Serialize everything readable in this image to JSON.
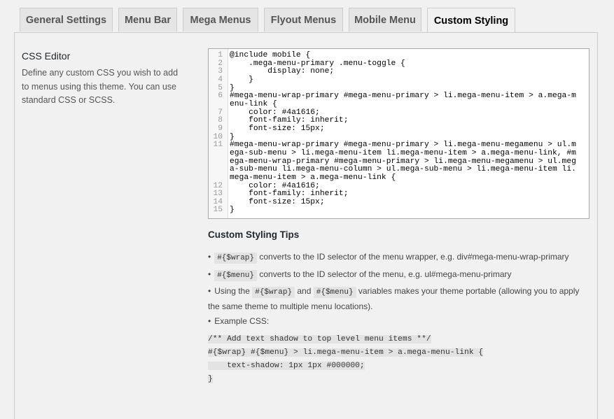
{
  "tabs": [
    {
      "label": "General Settings",
      "active": false
    },
    {
      "label": "Menu Bar",
      "active": false
    },
    {
      "label": "Mega Menus",
      "active": false
    },
    {
      "label": "Flyout Menus",
      "active": false
    },
    {
      "label": "Mobile Menu",
      "active": false
    },
    {
      "label": "Custom Styling",
      "active": true
    }
  ],
  "section": {
    "title": "CSS Editor",
    "description": "Define any custom CSS you wish to add to menus using this theme. You can use standard CSS or SCSS."
  },
  "editor": {
    "lines": [
      {
        "n": "1",
        "text": "@include mobile {"
      },
      {
        "n": "2",
        "text": "    .mega-menu-primary .menu-toggle {"
      },
      {
        "n": "3",
        "text": "        display: none;"
      },
      {
        "n": "4",
        "text": "    }"
      },
      {
        "n": "5",
        "text": "}"
      },
      {
        "n": "6",
        "text": "#mega-menu-wrap-primary #mega-menu-primary > li.mega-menu-item > a.mega-menu-link {"
      },
      {
        "n": "7",
        "text": "    color: #4a1616;"
      },
      {
        "n": "8",
        "text": "    font-family: inherit;"
      },
      {
        "n": "9",
        "text": "    font-size: 15px;"
      },
      {
        "n": "10",
        "text": "}"
      },
      {
        "n": "11",
        "text": "#mega-menu-wrap-primary #mega-menu-primary > li.mega-menu-megamenu > ul.mega-sub-menu > li.mega-menu-item li.mega-menu-item > a.mega-menu-link, #mega-menu-wrap-primary #mega-menu-primary > li.mega-menu-megamenu > ul.mega-sub-menu li.mega-menu-column > ul.mega-sub-menu > li.mega-menu-item li.mega-menu-item > a.mega-menu-link {"
      },
      {
        "n": "12",
        "text": "    color: #4a1616;"
      },
      {
        "n": "13",
        "text": "    font-family: inherit;"
      },
      {
        "n": "14",
        "text": "    font-size: 15px;"
      },
      {
        "n": "15",
        "text": "}"
      }
    ]
  },
  "tips": {
    "title": "Custom Styling Tips",
    "wrap_code": "#{$wrap}",
    "menu_code": "#{$menu}",
    "wrap_text": " converts to the ID selector of the menu wrapper, e.g. div#mega-menu-wrap-primary",
    "menu_text": " converts to the ID selector of the menu, e.g. ul#mega-menu-primary",
    "using_prefix": "Using the ",
    "using_and": " and ",
    "using_suffix": " variables makes your theme portable (allowing you to apply the same theme to multiple menu locations).",
    "example_label": "Example CSS:",
    "example_lines": [
      "/** Add text shadow to top level menu items **/",
      "#{$wrap} #{$menu} > li.mega-menu-item > a.mega-menu-link {",
      "    text-shadow: 1px 1px #000000;",
      "}"
    ]
  }
}
